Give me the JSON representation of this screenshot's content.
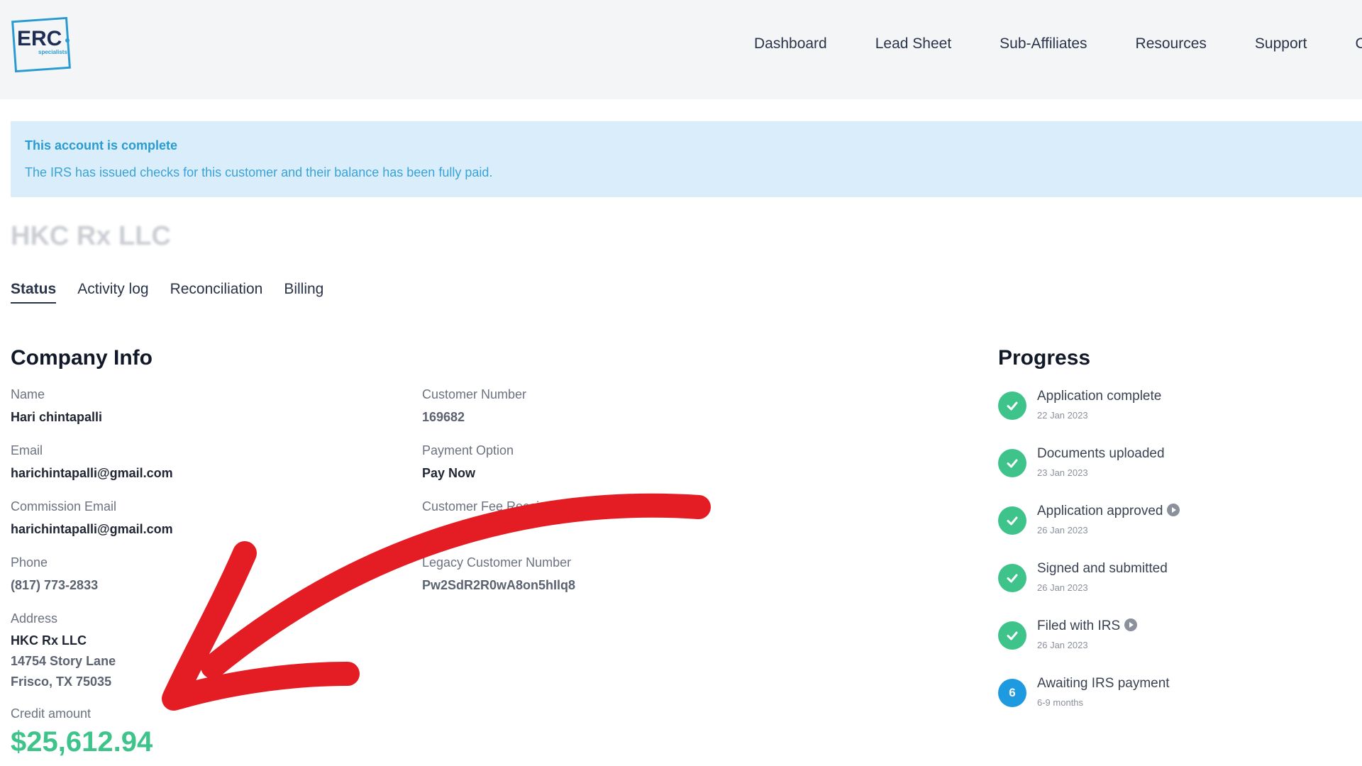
{
  "logo": {
    "text": "ERC",
    "subtext": "specialists"
  },
  "nav": {
    "items": [
      "Dashboard",
      "Lead Sheet",
      "Sub-Affiliates",
      "Resources",
      "Support",
      "Cl"
    ]
  },
  "alert": {
    "title": "This account is complete",
    "text": "The IRS has issued checks for this customer and their balance has been fully paid."
  },
  "company": {
    "name": "HKC Rx LLC"
  },
  "tabs": [
    "Status",
    "Activity log",
    "Reconciliation",
    "Billing"
  ],
  "company_info": {
    "title": "Company Info",
    "name_label": "Name",
    "name_value": "Hari chintapalli",
    "email_label": "Email",
    "email_value": "harichintapalli@gmail.com",
    "commission_email_label": "Commission Email",
    "commission_email_value": "harichintapalli@gmail.com",
    "phone_label": "Phone",
    "phone_value": "(817) 773-2833",
    "address_label": "Address",
    "address_line1": "HKC Rx LLC",
    "address_line2": "14754 Story Lane",
    "address_line3": "Frisco, TX 75035",
    "customer_number_label": "Customer Number",
    "customer_number_value": "169682",
    "payment_option_label": "Payment Option",
    "payment_option_value": "Pay Now",
    "customer_fee_label": "Customer Fee Recei",
    "legacy_label": "Legacy Customer Number",
    "legacy_value": "Pw2SdR2R0wA8on5hIlq8",
    "credit_label": "Credit amount",
    "credit_value": "$25,612.94"
  },
  "progress": {
    "title": "Progress",
    "steps": [
      {
        "title": "Application complete",
        "date": "22 Jan 2023"
      },
      {
        "title": "Documents uploaded",
        "date": "23 Jan 2023"
      },
      {
        "title": "Application approved",
        "date": "26 Jan 2023"
      },
      {
        "title": "Signed and submitted",
        "date": "26 Jan 2023"
      },
      {
        "title": "Filed with IRS",
        "date": "26 Jan 2023"
      },
      {
        "title": "Awaiting IRS payment",
        "date": "6-9 months",
        "number": "6"
      }
    ]
  },
  "colors": {
    "accent_green": "#3ec48b",
    "accent_blue": "#1e9be0",
    "alert_bg": "#d9eefa",
    "annotation_red": "#e41c24"
  }
}
